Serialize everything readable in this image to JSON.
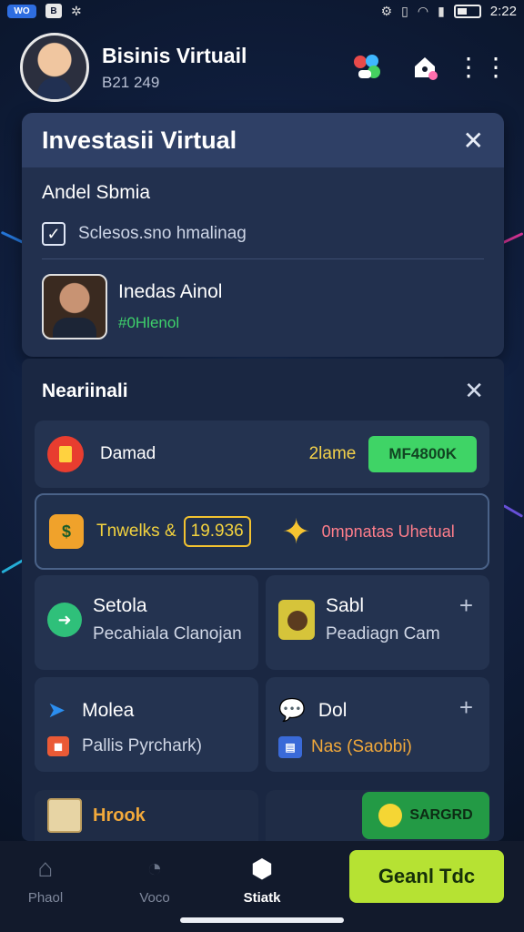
{
  "status_bar": {
    "carrier": "WO",
    "app_badge": "B",
    "time": "2:22"
  },
  "header": {
    "title": "Bisinis Virtuail",
    "subtitle": "B21 249"
  },
  "card": {
    "title": "Investasii Virtual",
    "section_label": "Andel Sbmia",
    "checkbox_text": "Sclesos.sno hmalinag",
    "profile_name": "Inedas Ainol",
    "profile_tag": "#0Hlenol"
  },
  "panel": {
    "title": "Neariinali",
    "row1": {
      "label": "Damad",
      "aux": "2lame",
      "button": "MF4800K"
    },
    "row2": {
      "label": "Tnwelks &",
      "value": "19.936",
      "right": "0mpnatas Uhetual"
    },
    "tiles": [
      {
        "title": "Setola",
        "sub": "Pecahiala Clanojan"
      },
      {
        "title": "Sabl",
        "sub": "Peadiagn Cam"
      },
      {
        "title": "Molea",
        "sub": "Pallis Pyrchark)"
      },
      {
        "title": "Dol",
        "sub": "Nas (Saobbi)"
      }
    ],
    "row5": {
      "label": "Hrook",
      "button": "SARGRD"
    }
  },
  "bottom_nav": {
    "items": [
      {
        "label": "Phaol"
      },
      {
        "label": "Voco"
      },
      {
        "label": "Stiatk"
      }
    ],
    "cta": "Geanl Tdc"
  },
  "colors": {
    "accent_green": "#3fd466",
    "cta": "#b6e233",
    "highlight_yellow": "#f2d23e"
  }
}
